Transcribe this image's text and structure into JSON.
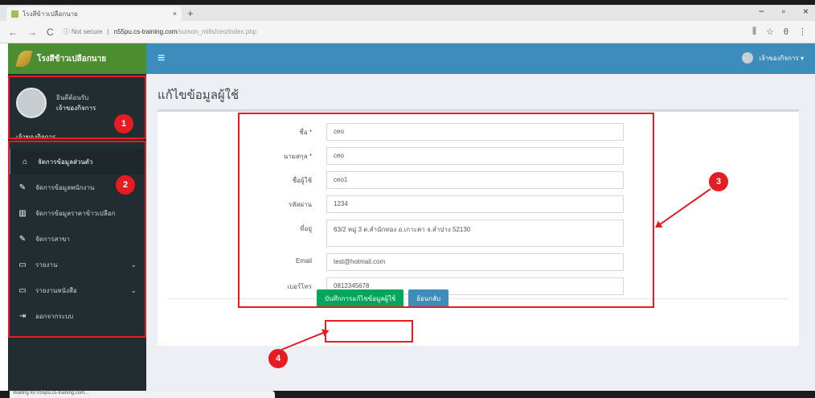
{
  "browser": {
    "tab_title": "โรงสีข้าวเปลือกนาย",
    "tab_close": "×",
    "new_tab": "+",
    "back": "←",
    "forward": "→",
    "reload": "C",
    "security": "ⓘ Not secure",
    "url_host": "n55pu.cs-training.com",
    "url_path": "/sumon_mills/ceo/index.php",
    "translate": "⫼",
    "star": "☆",
    "account": "θ",
    "menu": "⋮",
    "win_min": "−",
    "win_max": "▫",
    "win_close": "×"
  },
  "app": {
    "brand": "โรงสีข้าวเปลือกนาย",
    "hamburger": "≡",
    "top_user": "เจ้าของกิจการ ▾",
    "user_panel": {
      "line1": "ยินดีต้อนรับ",
      "line2": "เจ้าของกิจการ",
      "role": "เจ้าของกิจการ"
    },
    "menu": [
      {
        "icon": "home-icon",
        "glyph": "⌂",
        "label": "จัดการข้อมูลส่วนตัว",
        "active": true,
        "chev": ""
      },
      {
        "icon": "edit-icon",
        "glyph": "✎",
        "label": "จัดการข้อมูลพนักงาน",
        "active": false,
        "chev": ""
      },
      {
        "icon": "chart-icon",
        "glyph": "▥",
        "label": "จัดการข้อมูลราคาข้าวเปลือก",
        "active": false,
        "chev": ""
      },
      {
        "icon": "edit-icon",
        "glyph": "✎",
        "label": "จัดการสาขา",
        "active": false,
        "chev": ""
      },
      {
        "icon": "monitor-icon",
        "glyph": "▭",
        "label": "รายงาน",
        "active": false,
        "chev": "⌄"
      },
      {
        "icon": "monitor-icon",
        "glyph": "▭",
        "label": "รายงานหนังสือ",
        "active": false,
        "chev": "⌄"
      },
      {
        "icon": "signout-icon",
        "glyph": "⇥",
        "label": "ออกจากระบบ",
        "active": false,
        "chev": ""
      }
    ]
  },
  "page": {
    "title": "แก้ไขข้อมูลผู้ใช้",
    "fields": [
      {
        "label": "ชื่อ *",
        "value": "ceo"
      },
      {
        "label": "นามสกุล *",
        "value": "ceo"
      },
      {
        "label": "ชื่อผู้ใช้",
        "value": "ceo1"
      },
      {
        "label": "รหัสผ่าน",
        "value": "1234"
      },
      {
        "label": "ที่อยู่",
        "value": "63/2 หมู่ 3 ต.สำนักทอง อ.เกาะคา จ.ลำปาง 52130"
      },
      {
        "label": "Email",
        "value": "test@hotmail.com"
      },
      {
        "label": "เบอร์โทร",
        "value": "0812345678"
      }
    ],
    "save_button": "บันทึกการแก้ไขข้อมูลผู้ใช้",
    "back_button": "ย้อนกลับ"
  },
  "annotations": {
    "badge1": "1",
    "badge2": "2",
    "badge3": "3",
    "badge4": "4",
    "color": "#e51c23"
  },
  "status_text": "Waiting for n55pu.cs-training.com..."
}
